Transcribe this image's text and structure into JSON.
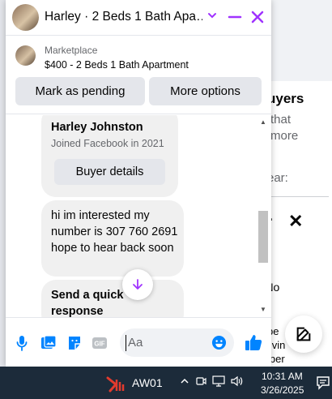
{
  "background": {
    "right_card": {
      "heading_fragment": "uyers",
      "line1": "that",
      "line2": "more",
      "line3": "ear:",
      "fragment_no": "*No",
      "fragment_b1": "be",
      "fragment_b2": "livin",
      "fragment_b3": "iber"
    }
  },
  "chat": {
    "header": {
      "title": "Harley · 2 Beds 1 Bath Apa…"
    },
    "listing": {
      "category": "Marketplace",
      "price_title": "$400 - 2 Beds 1 Bath Apartment",
      "pending_label": "Mark as pending",
      "more_label": "More options"
    },
    "messages": {
      "card_name": "Harley Johnston",
      "card_joined": "Joined Facebook in 2021",
      "card_button": "Buyer details",
      "message_text": "hi im interested my number is 307 760 2691 hope to hear back soon",
      "quick_response": "Send a quick response"
    },
    "composer": {
      "placeholder": "Aa"
    }
  },
  "taskbar": {
    "app_label": "AW01",
    "time": "10:31 AM",
    "date": "3/26/2025"
  },
  "colors": {
    "accent": "#a033ff",
    "messenger_blue": "#0084ff",
    "taskbar": "#1c2b3a"
  }
}
